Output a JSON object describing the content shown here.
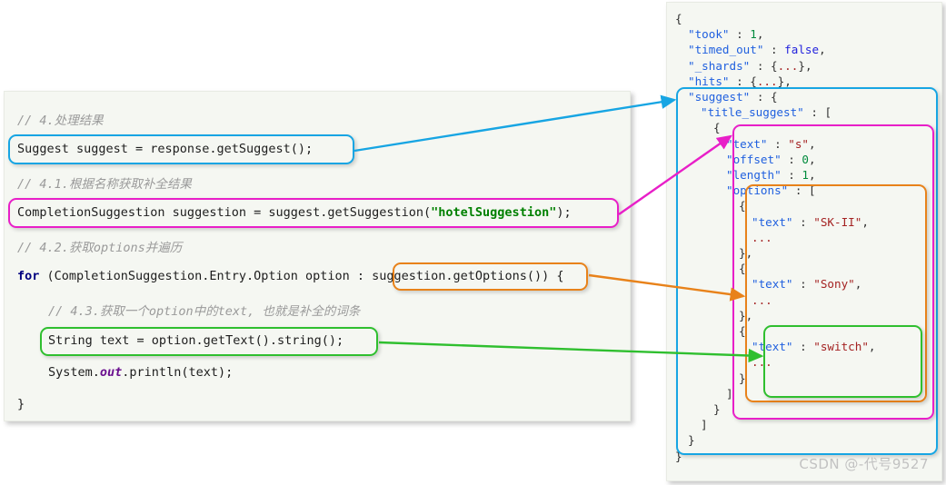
{
  "colors": {
    "blue": "#17a5e3",
    "magenta": "#e81fc8",
    "orange": "#e8821a",
    "green": "#2fbf2f",
    "panel_bg": "#f5f7f2",
    "comment": "#9a9a9a",
    "keyword": "#00007f",
    "string": "#008000",
    "json_key": "#2060df",
    "json_string": "#a42222",
    "json_number": "#008a3c"
  },
  "code_panel": {
    "lines": [
      {
        "id": "c1",
        "text": "// 4.处理结果"
      },
      {
        "id": "c2",
        "text": "Suggest suggest = response.getSuggest();"
      },
      {
        "id": "c3",
        "text": "// 4.1.根据名称获取补全结果"
      },
      {
        "id": "c4a",
        "text": "CompletionSuggestion suggestion = suggest.getSuggestion("
      },
      {
        "id": "c4b",
        "text": "\"hotelSuggestion\""
      },
      {
        "id": "c4c",
        "text": ");"
      },
      {
        "id": "c5",
        "text": "// 4.2.获取options并遍历"
      },
      {
        "id": "c6a",
        "text": "for"
      },
      {
        "id": "c6b",
        "text": " (CompletionSuggestion.Entry.Option option : "
      },
      {
        "id": "c6c",
        "text": "suggestion.getOptions()"
      },
      {
        "id": "c6d",
        "text": ") {"
      },
      {
        "id": "c7",
        "text": "// 4.3.获取一个option中的text, 也就是补全的词条"
      },
      {
        "id": "c8",
        "text": "String text = option.getText().string();"
      },
      {
        "id": "c9a",
        "text": "System."
      },
      {
        "id": "c9b",
        "text": "out"
      },
      {
        "id": "c9c",
        "text": ".println(text);"
      },
      {
        "id": "c10",
        "text": "}"
      }
    ]
  },
  "json_panel": {
    "lines": [
      {
        "id": "j1",
        "indent": 0,
        "text": "{"
      },
      {
        "id": "j2",
        "indent": 1,
        "key": "\"took\"",
        "sep": " : ",
        "num": "1",
        "tail": ","
      },
      {
        "id": "j3",
        "indent": 1,
        "key": "\"timed_out\"",
        "sep": " : ",
        "bool": "false",
        "tail": ","
      },
      {
        "id": "j4",
        "indent": 1,
        "key": "\"_shards\"",
        "sep": " : ",
        "obj_open": "{",
        "dots": "...",
        "obj_close": "}",
        "tail": ","
      },
      {
        "id": "j5",
        "indent": 1,
        "key": "\"hits\"",
        "sep": " : ",
        "obj_open": "{",
        "dots": "...",
        "obj_close": "}",
        "tail": ","
      },
      {
        "id": "j6",
        "indent": 1,
        "key": "\"suggest\"",
        "sep": " : ",
        "tail": "{"
      },
      {
        "id": "j7",
        "indent": 2,
        "key": "\"title_suggest\"",
        "sep": " : ",
        "tail": "["
      },
      {
        "id": "j8",
        "indent": 3,
        "text": "{"
      },
      {
        "id": "j9",
        "indent": 4,
        "key": "\"text\"",
        "sep": " : ",
        "str": "\"s\"",
        "tail": ","
      },
      {
        "id": "j10",
        "indent": 4,
        "key": "\"offset\"",
        "sep": " : ",
        "num": "0",
        "tail": ","
      },
      {
        "id": "j11",
        "indent": 4,
        "key": "\"length\"",
        "sep": " : ",
        "num": "1",
        "tail": ","
      },
      {
        "id": "j12",
        "indent": 4,
        "key": "\"options\"",
        "sep": " : ",
        "tail": "["
      },
      {
        "id": "j13",
        "indent": 5,
        "text": "{"
      },
      {
        "id": "j14",
        "indent": 6,
        "key": "\"text\"",
        "sep": " : ",
        "str": "\"SK-II\"",
        "tail": ","
      },
      {
        "id": "j15",
        "indent": 6,
        "dots": "..."
      },
      {
        "id": "j16",
        "indent": 5,
        "text": "},"
      },
      {
        "id": "j17",
        "indent": 5,
        "text": "{"
      },
      {
        "id": "j18",
        "indent": 6,
        "key": "\"text\"",
        "sep": " : ",
        "str": "\"Sony\"",
        "tail": ","
      },
      {
        "id": "j19",
        "indent": 6,
        "dots": "..."
      },
      {
        "id": "j20",
        "indent": 5,
        "text": "},"
      },
      {
        "id": "j21",
        "indent": 5,
        "text": "{"
      },
      {
        "id": "j22",
        "indent": 6,
        "key": "\"text\"",
        "sep": " : ",
        "str": "\"switch\"",
        "tail": ","
      },
      {
        "id": "j23",
        "indent": 6,
        "dots": "..."
      },
      {
        "id": "j24",
        "indent": 5,
        "text": "}"
      },
      {
        "id": "j25",
        "indent": 4,
        "text": "]"
      },
      {
        "id": "j26",
        "indent": 3,
        "text": "}"
      },
      {
        "id": "j27",
        "indent": 2,
        "text": "]"
      },
      {
        "id": "j28",
        "indent": 1,
        "text": "}"
      },
      {
        "id": "j29",
        "indent": 0,
        "text": "}"
      }
    ]
  },
  "highlights": [
    {
      "id": "hl-blue-code",
      "color": "blue",
      "label": "suggest-statement-box"
    },
    {
      "id": "hl-magenta-code",
      "color": "magenta",
      "label": "suggestion-statement-box"
    },
    {
      "id": "hl-orange-code",
      "color": "orange",
      "label": "get-options-box"
    },
    {
      "id": "hl-green-code",
      "color": "green",
      "label": "get-text-box"
    },
    {
      "id": "hl-blue-json",
      "color": "blue",
      "label": "suggest-node-box"
    },
    {
      "id": "hl-magenta-json",
      "color": "magenta",
      "label": "title-suggest-entry-box"
    },
    {
      "id": "hl-orange-json",
      "color": "orange",
      "label": "options-array-box"
    },
    {
      "id": "hl-green-json",
      "color": "green",
      "label": "option-switch-box"
    }
  ],
  "watermark": {
    "text": "CSDN @-代号9527"
  }
}
